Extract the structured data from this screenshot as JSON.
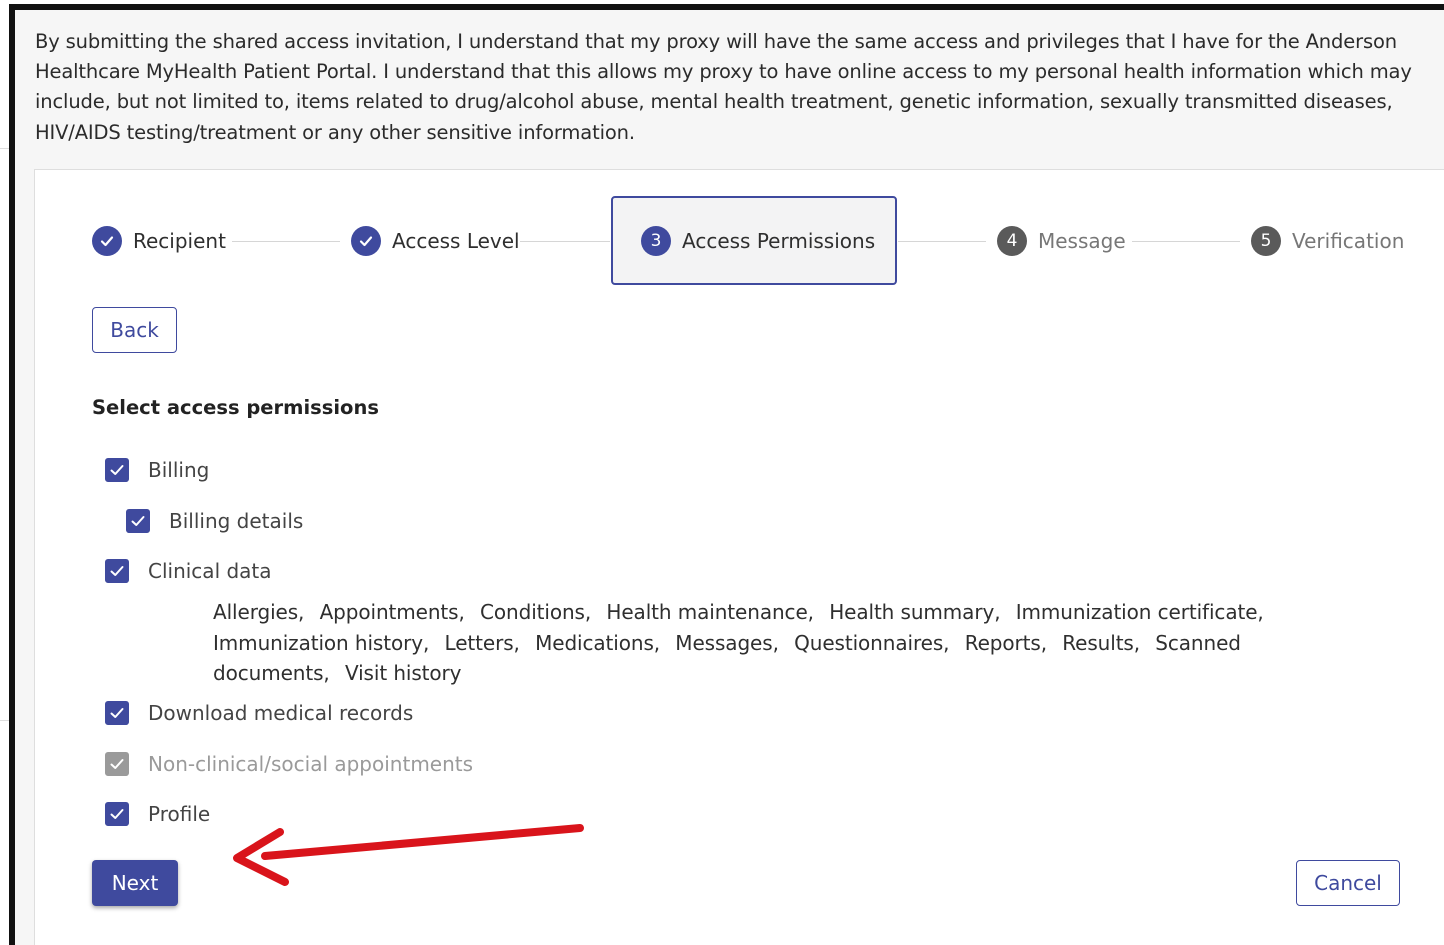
{
  "disclaimer": {
    "text": "By submitting the shared access invitation, I understand that my proxy will have the same access and privileges that I have for the Anderson Healthcare MyHealth Patient Portal. I understand that this allows my proxy to have online access to my personal health information which may include, but not limited to, items related to drug/alcohol abuse, mental health treatment, genetic information, sexually transmitted diseases, HIV/AIDS testing/treatment or any other sensitive information."
  },
  "stepper": {
    "steps": [
      {
        "label": "Recipient",
        "number": "1",
        "state": "done"
      },
      {
        "label": "Access Level",
        "number": "2",
        "state": "done"
      },
      {
        "label": "Access Permissions",
        "number": "3",
        "state": "active"
      },
      {
        "label": "Message",
        "number": "4",
        "state": "pending"
      },
      {
        "label": "Verification",
        "number": "5",
        "state": "pending"
      }
    ]
  },
  "buttons": {
    "back": "Back",
    "next": "Next",
    "cancel": "Cancel"
  },
  "permissions": {
    "title": "Select access permissions",
    "items": [
      {
        "label": "Billing",
        "checked": true,
        "disabled": false
      },
      {
        "label": "Billing details",
        "checked": true,
        "disabled": false
      },
      {
        "label": "Clinical data",
        "checked": true,
        "disabled": false
      },
      {
        "label": "Download medical records",
        "checked": true,
        "disabled": false
      },
      {
        "label": "Non-clinical/social appointments",
        "checked": true,
        "disabled": true
      },
      {
        "label": "Profile",
        "checked": true,
        "disabled": false
      }
    ],
    "clinical_items": [
      "Allergies,",
      "Appointments,",
      "Conditions,",
      "Health maintenance,",
      "Health summary,",
      "Immunization certificate,",
      "Immunization history,",
      "Letters,",
      "Medications,",
      "Messages,",
      "Questionnaires,",
      "Reports,",
      "Results,",
      "Scanned documents,",
      "Visit history"
    ]
  },
  "colors": {
    "accent": "#3f4a9e",
    "annotation_arrow": "#d9141b",
    "disabled": "#9a9a9a"
  },
  "icons": {
    "step_done": "check-circle-icon",
    "checkbox": "checkbox-checked-icon",
    "annotation": "red-arrow-annotation"
  }
}
